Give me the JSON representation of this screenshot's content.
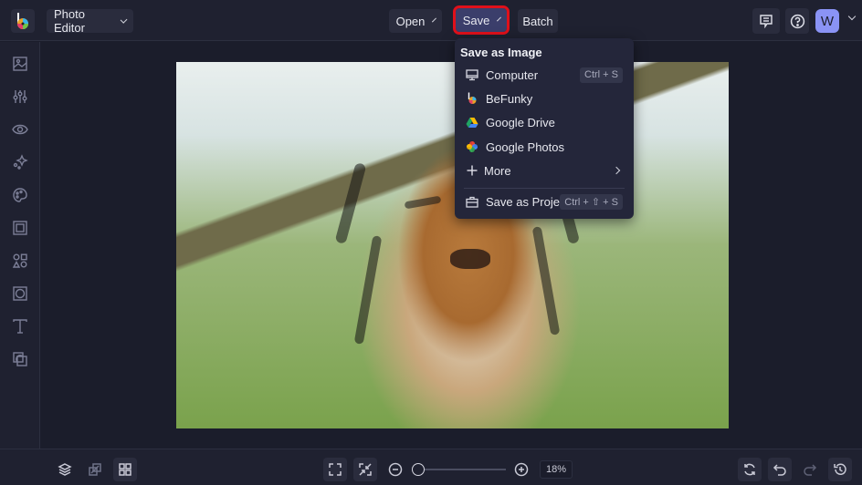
{
  "topbar": {
    "app_menu_label": "Photo Editor",
    "open_label": "Open",
    "save_label": "Save",
    "batch_label": "Batch",
    "avatar_initial": "W"
  },
  "sidebar": {
    "items": [
      {
        "icon": "image-icon",
        "label": "Edit"
      },
      {
        "icon": "sliders-icon",
        "label": "Adjust"
      },
      {
        "icon": "eye-icon",
        "label": "Touch Up"
      },
      {
        "icon": "sparkles-icon",
        "label": "Effects"
      },
      {
        "icon": "palette-icon",
        "label": "Artsy"
      },
      {
        "icon": "frame-icon",
        "label": "Frames"
      },
      {
        "icon": "shapes-icon",
        "label": "Graphics"
      },
      {
        "icon": "overlay-icon",
        "label": "Overlays"
      },
      {
        "icon": "text-icon",
        "label": "Text"
      },
      {
        "icon": "textures-icon",
        "label": "Textures"
      }
    ]
  },
  "save_menu": {
    "title": "Save as Image",
    "items": [
      {
        "label": "Computer",
        "icon": "monitor-icon",
        "shortcut": "Ctrl + S"
      },
      {
        "label": "BeFunky",
        "icon": "befunky-icon",
        "shortcut": ""
      },
      {
        "label": "Google Drive",
        "icon": "google-drive-icon",
        "shortcut": ""
      },
      {
        "label": "Google Photos",
        "icon": "google-photos-icon",
        "shortcut": ""
      },
      {
        "label": "More",
        "icon": "plus-icon",
        "shortcut": ""
      }
    ],
    "project": {
      "label": "Save as Project",
      "icon": "briefcase-icon",
      "shortcut": "Ctrl + ⇧ + S"
    }
  },
  "bottombar": {
    "zoom_value": "18%",
    "zoom_fraction": 0.0
  },
  "colors": {
    "accent": "#8a93f5",
    "highlight": "#e0101a",
    "background": "#1b1d2b"
  }
}
